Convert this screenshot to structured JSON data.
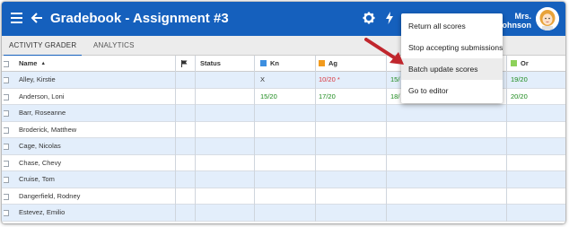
{
  "app": {
    "title": "Gradebook - Assignment #3",
    "user_line1": "Mrs.",
    "user_line2": "Johnson"
  },
  "tabs": [
    {
      "label": "ACTIVITY GRADER",
      "active": true
    },
    {
      "label": "ANALYTICS",
      "active": false
    }
  ],
  "table": {
    "columns": [
      "Name",
      "Status",
      "Kn",
      "Ag",
      "Or"
    ],
    "sort_indicator": "▲",
    "col_colors": {
      "Kn": "#3d8fe0",
      "Ag": "#f29b1d",
      "Or": "#8dd15a",
      "hidden": "#3aa83a"
    },
    "rows": [
      {
        "name": "Alley, Kirstie",
        "kn": "X",
        "ag": "10/20 *",
        "hidden": "15/",
        "or": "19/20"
      },
      {
        "name": "Anderson, Loni",
        "kn": "15/20",
        "ag": "17/20",
        "hidden": "18/",
        "or": "20/20"
      },
      {
        "name": "Barr, Roseanne",
        "kn": "",
        "ag": "",
        "hidden": "",
        "or": ""
      },
      {
        "name": "Broderick, Matthew",
        "kn": "",
        "ag": "",
        "hidden": "",
        "or": ""
      },
      {
        "name": "Cage, Nicolas",
        "kn": "",
        "ag": "",
        "hidden": "",
        "or": ""
      },
      {
        "name": "Chase, Chevy",
        "kn": "",
        "ag": "",
        "hidden": "",
        "or": ""
      },
      {
        "name": "Cruise, Tom",
        "kn": "",
        "ag": "",
        "hidden": "",
        "or": ""
      },
      {
        "name": "Dangerfield, Rodney",
        "kn": "",
        "ag": "",
        "hidden": "",
        "or": ""
      },
      {
        "name": "Estevez, Emilio",
        "kn": "",
        "ag": "",
        "hidden": "",
        "or": ""
      }
    ]
  },
  "menu": {
    "items": [
      {
        "label": "Return all scores",
        "highlighted": false
      },
      {
        "label": "Stop accepting submissions",
        "highlighted": false
      },
      {
        "label": "Batch update scores",
        "highlighted": true
      },
      {
        "label": "Go to editor",
        "highlighted": false
      }
    ]
  },
  "colors": {
    "appbar": "#1560bd",
    "arrow": "#c0262d"
  }
}
